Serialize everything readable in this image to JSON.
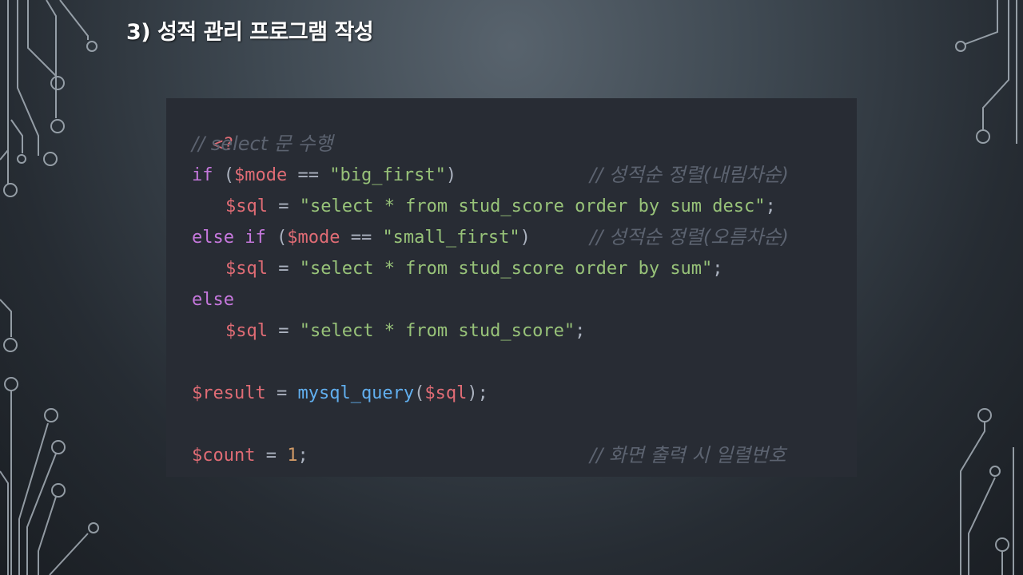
{
  "slide": {
    "title": "3) 성적 관리 프로그램 작성"
  },
  "colors": {
    "code_background": "#282c34",
    "keyword": "#c678dd",
    "variable": "#e06c75",
    "string": "#98c379",
    "function": "#61afef",
    "number": "#d19a66",
    "comment": "#5c6370"
  },
  "code": {
    "open_tag": "<?",
    "line1": {
      "comment": "// select 문 수행"
    },
    "line2": {
      "kw": "if",
      "paren_open": " (",
      "var": "$mode",
      "op": " == ",
      "str": "\"big_first\"",
      "paren_close": ")",
      "comment": "// 성적순 정렬(내림차순)"
    },
    "line3": {
      "var": "$sql",
      "op": " = ",
      "str": "\"select * from stud_score order by sum desc\"",
      "end": ";"
    },
    "line4": {
      "kw": "else if",
      "paren_open": " (",
      "var": "$mode",
      "op": " == ",
      "str": "\"small_first\"",
      "paren_close": ")",
      "comment": "// 성적순 정렬(오름차순)"
    },
    "line5": {
      "var": "$sql",
      "op": " = ",
      "str": "\"select * from stud_score order by sum\"",
      "end": ";"
    },
    "line6": {
      "kw": "else"
    },
    "line7": {
      "var": "$sql",
      "op": " = ",
      "str": "\"select * from stud_score\"",
      "end": ";"
    },
    "line8": {
      "var": "$result",
      "op": " = ",
      "fn": "mysql_query",
      "paren_open": "(",
      "arg": "$sql",
      "paren_close": ");"
    },
    "line9": {
      "var": "$count",
      "op": " = ",
      "num": "1",
      "end": ";",
      "comment": "// 화면 출력 시 일렬번호"
    }
  }
}
